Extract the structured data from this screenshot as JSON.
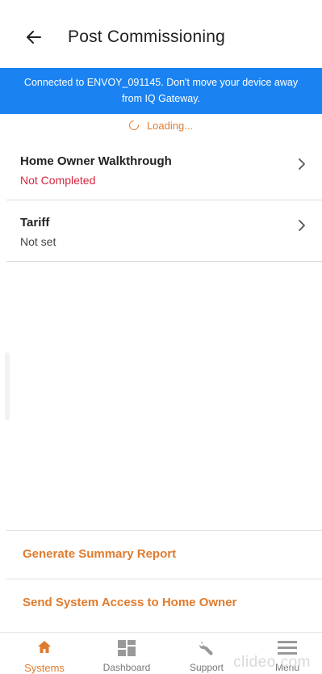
{
  "header": {
    "title": "Post Commissioning"
  },
  "banner": {
    "line1": "Connected to ENVOY_091145. Don't move your device away",
    "line2": "from IQ Gateway."
  },
  "loading": {
    "text": "Loading..."
  },
  "items": [
    {
      "title": "Home Owner Walkthrough",
      "status": "Not Completed"
    },
    {
      "title": "Tariff",
      "status": "Not set"
    }
  ],
  "actions": {
    "summary_report": "Generate Summary Report",
    "send_access": "Send System Access to Home Owner"
  },
  "tabs": [
    {
      "label": "Systems",
      "icon": "home-icon"
    },
    {
      "label": "Dashboard",
      "icon": "dashboard-icon"
    },
    {
      "label": "Support",
      "icon": "wrench-icon"
    },
    {
      "label": "Menu",
      "icon": "menu-icon"
    }
  ],
  "watermark": "clideo.com",
  "colors": {
    "accent": "#e07b2e",
    "banner": "#1a83f1",
    "warning": "#d7263d"
  }
}
